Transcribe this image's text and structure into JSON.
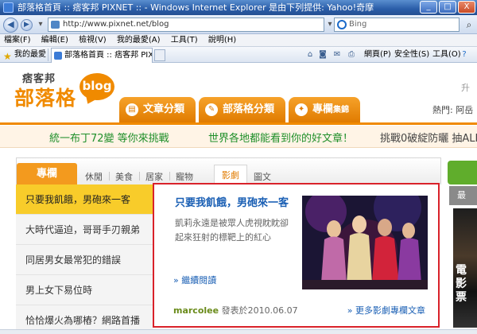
{
  "window": {
    "title": "部落格首頁 :: 痞客邦 PIXNET :: - Windows Internet Explorer 是由下列提供: Yahoo!奇摩",
    "buttons": {
      "minimize": "_",
      "maximize": "□",
      "close": "X"
    }
  },
  "address": {
    "url": "http://www.pixnet.net/blog",
    "search_placeholder": "Bing"
  },
  "menu": [
    "檔案(F)",
    "編輯(E)",
    "檢視(V)",
    "我的最愛(A)",
    "工具(T)",
    "說明(H)"
  ],
  "favbar": {
    "favorites_label": "我的最愛",
    "tab_title": "部落格首頁 :: 痞客邦 PIXNET ::",
    "commands": [
      "網頁(P)",
      "安全性(S)",
      "工具(O)"
    ]
  },
  "site": {
    "logo_sub": "痞客邦",
    "logo_main": "部落格",
    "logo_bubble": "blog",
    "right_fragment": "升",
    "nav_tabs": [
      {
        "label": "文章分類",
        "suffix": ""
      },
      {
        "label": "部落格分類",
        "suffix": ""
      },
      {
        "label": "專欄",
        "suffix": "集錦"
      }
    ],
    "hot_label": "熱門: 阿岳",
    "promos": [
      "統一布丁72變 等你來挑戰",
      "世界各地都能看到你的好文章！",
      "挑戰0破綻防曬 抽ALL"
    ],
    "categories": {
      "active": "專欄",
      "items": [
        "休閒",
        "美食",
        "居家",
        "寵物",
        "影劇",
        "圖文"
      ],
      "selected": "影劇"
    },
    "side_gray_label": "最",
    "side_photo_text": "電影票"
  },
  "list": [
    "只要我飢餓，男砲來一客",
    "大時代逼迫，哥哥手刃親弟",
    "同居男女最常犯的錯誤",
    "男上女下易位時",
    "恰恰爆火為哪樁？網路首播"
  ],
  "feature": {
    "title": "只要我飢餓，男砲來一客",
    "excerpt": "凱莉永遠是被眾人虎視眈眈卻起來狂射的標靶上的紅心",
    "more": "» 繼續閱讀",
    "author": "marcolee",
    "date_text": "發表於2010.06.07",
    "more_column": "» 更多影劇專欄文章"
  }
}
